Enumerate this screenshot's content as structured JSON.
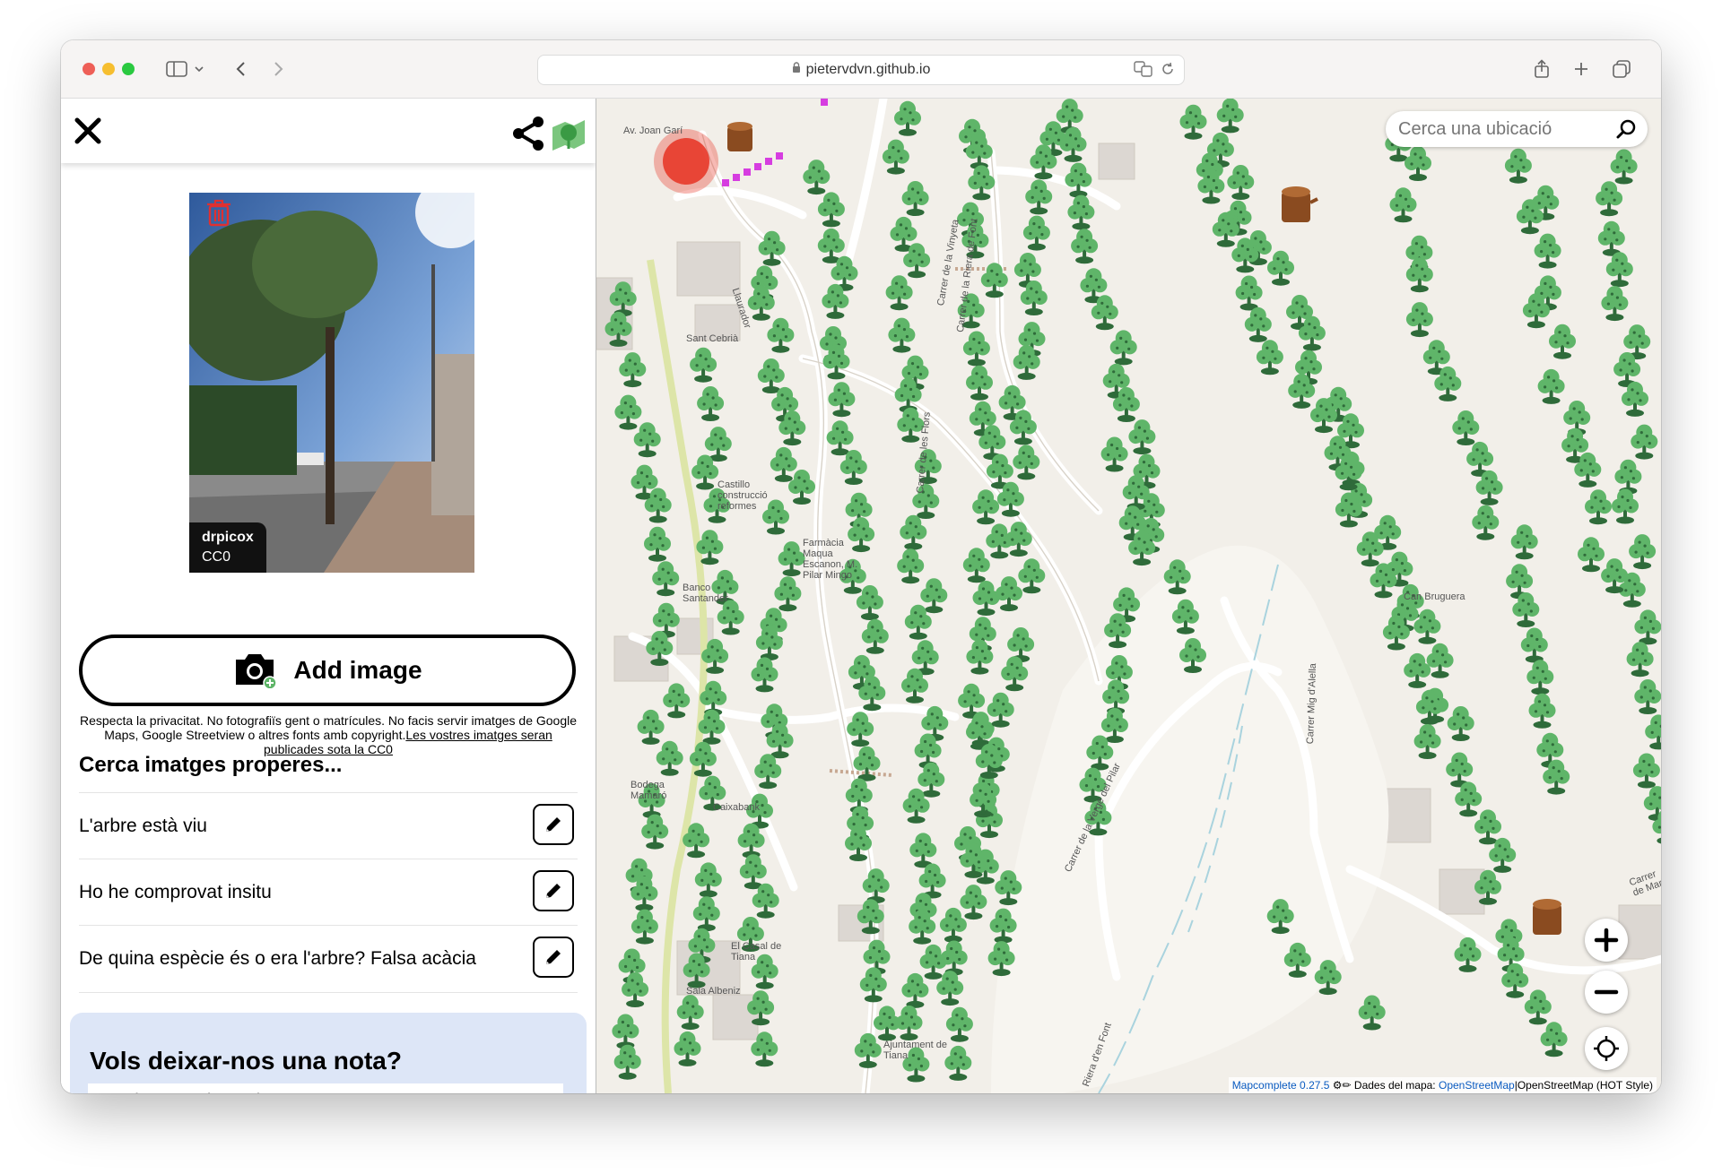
{
  "browser": {
    "url": "pietervdvn.github.io"
  },
  "sidebar": {
    "image_credit": {
      "author": "drpicox",
      "license": "CC0"
    },
    "add_image_label": "Add image",
    "privacy_text": "Respecta la privacitat. No fotografiïs gent o matrícules. No facis servir imatges de Google Maps, Google Streetview o altres fonts amb copyright.",
    "privacy_link": "Les vostres imatges seran publicades sota la CC0",
    "nearby_title": "Cerca imatges properes...",
    "questions": [
      {
        "text": "L'arbre està viu"
      },
      {
        "text": "Ho he comprovat insitu"
      },
      {
        "text": "De quina espècie és o era l'arbre? Falsa acàcia"
      }
    ],
    "note": {
      "title": "Vols deixar-nos una nota?",
      "placeholder": "nota (un tros de text)"
    }
  },
  "map": {
    "search_placeholder": "Cerca una ubicació",
    "attribution": {
      "mapcomplete": "Mapcomplete 0.27.5",
      "data_prefix": "Dades del mapa: ",
      "data_link": "OpenStreetMap",
      "style": "OpenStreetMap (HOT Style)"
    },
    "street_labels": [
      "Carrer de la Riera de Font",
      "Carrer de la Vinyeta",
      "Carrer de les Flors",
      "Llaurador",
      "Carrer de la Verge del Pilar",
      "Carrer Mig d'Alella",
      "Riera d'en Font",
      "Carrer de Mar"
    ],
    "poi_labels": [
      "Av. Joan Garí",
      "Sant Cebrià",
      "Castillo construcció reformes",
      "Farmàcia Maqua Escanon, M. Pilar Mingo",
      "Banco Santander",
      "Bodega Mamaró",
      "Caixabank",
      "El Casal de Tiana",
      "Sala Albeniz",
      "Ajuntament de Tiana",
      "Can Bruguera"
    ],
    "tree_color": "#5fb569",
    "selected_color": "#e83a2a"
  }
}
